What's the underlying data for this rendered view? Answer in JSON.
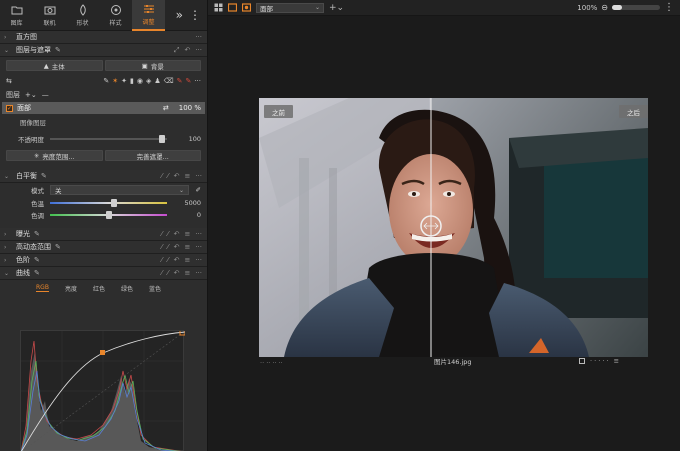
{
  "toolbar": {
    "tabs": [
      {
        "label": "图库",
        "icon": "folder-icon"
      },
      {
        "label": "联机",
        "icon": "camera-icon"
      },
      {
        "label": "形状",
        "icon": "shape-icon"
      },
      {
        "label": "样式",
        "icon": "style-icon"
      },
      {
        "label": "调整",
        "icon": "adjust-icon",
        "active": true
      }
    ]
  },
  "panel": {
    "histogram": "直方图",
    "layers_masks": "图层与遮罩",
    "subject_btn": "主体",
    "background_btn": "背景",
    "layers_label": "图层",
    "layer": {
      "name": "面部",
      "opacity_text": "100 %"
    },
    "layer_sub": "图像图层",
    "opacity_label": "不透明度",
    "opacity_value": "100",
    "luma_btn": "亮度范围...",
    "refine_btn": "完善遮罩...",
    "white_balance": "白平衡",
    "mode_label": "模式",
    "mode_value": "关",
    "temp_label": "色温",
    "temp_value": "5000",
    "tint_label": "色调",
    "tint_value": "0",
    "exposure": "曝光",
    "hdr": "高动态范围",
    "levels": "色阶",
    "curve": "曲线",
    "curve_tabs": [
      "RGB",
      "亮度",
      "红色",
      "绿色",
      "蓝色"
    ]
  },
  "topbar": {
    "variant": "面部",
    "zoom": "100%"
  },
  "viewer": {
    "before_label": "之前",
    "after_label": "之后",
    "filename": "图片146.jpg",
    "left_dots": "..  ..  ..  .."
  },
  "colors": {
    "accent": "#e8852b",
    "panel": "#2d2d2d",
    "viewer_bg": "#1b1b1b"
  }
}
